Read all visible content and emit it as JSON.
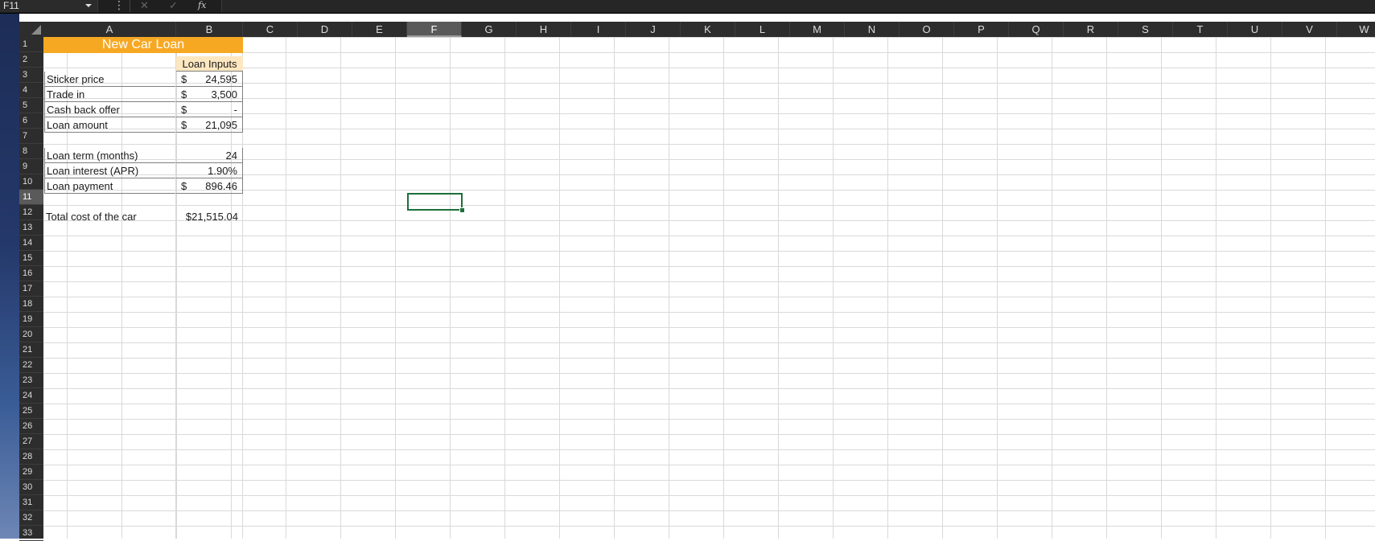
{
  "formula_bar": {
    "name_box": "F11",
    "more_glyph": "⋮",
    "cancel_glyph": "✕",
    "enter_glyph": "✓",
    "fx_label": "fx",
    "formula_value": ""
  },
  "selected_cell": "F11",
  "columns": [
    "A",
    "B",
    "C",
    "D",
    "E",
    "F",
    "G",
    "H",
    "I",
    "J",
    "K",
    "L",
    "M",
    "N",
    "O",
    "P",
    "Q",
    "R",
    "S",
    "T",
    "U",
    "V",
    "W"
  ],
  "rows": [
    "1",
    "2",
    "3",
    "4",
    "5",
    "6",
    "7",
    "8",
    "9",
    "10",
    "11",
    "12",
    "13",
    "14",
    "15",
    "16",
    "17",
    "18",
    "19",
    "20",
    "21",
    "22",
    "23",
    "24",
    "25",
    "26",
    "27",
    "28",
    "29",
    "30",
    "31",
    "32",
    "33"
  ],
  "sheet": {
    "title": "New Car Loan",
    "inputs_header": "Loan Inputs",
    "items": [
      {
        "label": "Sticker price",
        "currency": "$",
        "value": "24,595"
      },
      {
        "label": "Trade in",
        "currency": "$",
        "value": "3,500"
      },
      {
        "label": "Cash back offer",
        "currency": "$",
        "value": "-"
      },
      {
        "label": "Loan amount",
        "currency": "$",
        "value": "21,095"
      },
      {
        "label": "Loan term (months)",
        "currency": "",
        "value": "24"
      },
      {
        "label": "Loan interest (APR)",
        "currency": "",
        "value": "1.90%"
      },
      {
        "label": "Loan payment",
        "currency": "$",
        "value": "896.46"
      },
      {
        "label": "Total cost of the car",
        "currency": "",
        "value": "$21,515.04"
      }
    ]
  },
  "colors": {
    "title_fill": "#f7a823",
    "inputs_header_fill": "#fde7c0",
    "selection_border": "#1e6e3a",
    "header_background": "#2d2d2d"
  }
}
